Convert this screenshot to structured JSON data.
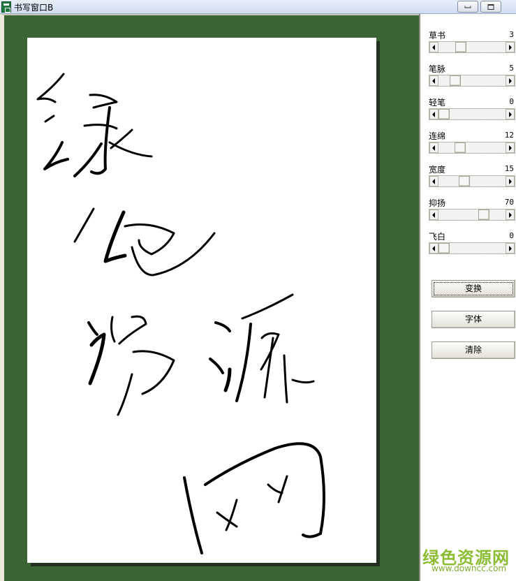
{
  "window": {
    "title": "书写窗口B",
    "minimize_icon": "minimize-icon",
    "maximize_icon": "maximize-icon"
  },
  "panel": {
    "params": [
      {
        "label": "草书",
        "value": "3",
        "level": 0.3
      },
      {
        "label": "笔脉",
        "value": "5",
        "level": 0.2
      },
      {
        "label": "轻笔",
        "value": "0",
        "level": 0.0
      },
      {
        "label": "连绵",
        "value": "12",
        "level": 0.29
      },
      {
        "label": "宽度",
        "value": "15",
        "level": 0.36
      },
      {
        "label": "抑扬",
        "value": "70",
        "level": 0.71
      },
      {
        "label": "飞白",
        "value": "0",
        "level": 0.0
      }
    ],
    "buttons": {
      "transform": "变换",
      "font": "字体",
      "clear": "清除"
    }
  },
  "watermark": {
    "text": "绿色资源网",
    "url": "www.downcc.com"
  },
  "colors": {
    "canvas_bg": "#3b6434",
    "paper": "#ffffff",
    "ink": "#000000",
    "watermark": "#8dbd35"
  }
}
